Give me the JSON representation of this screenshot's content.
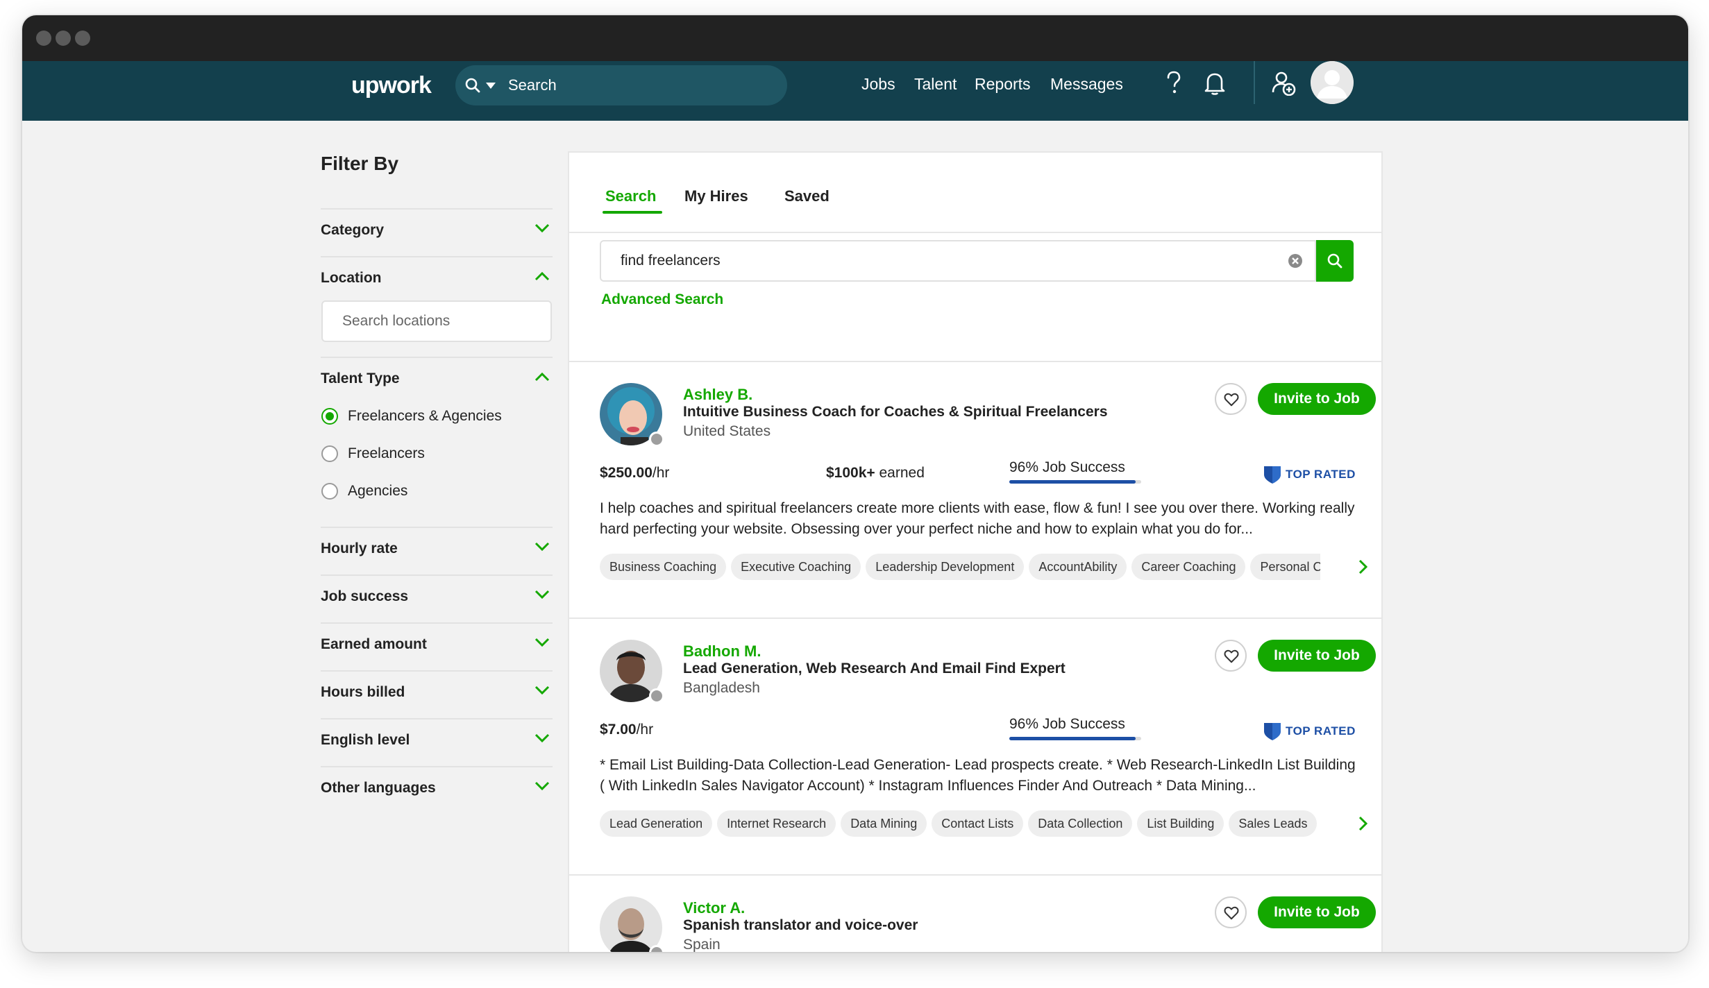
{
  "nav": {
    "logo": "upwork",
    "search_placeholder": "Search",
    "links": [
      "Jobs",
      "Talent",
      "Reports",
      "Messages"
    ],
    "help_icon": "help-icon",
    "bell_icon": "bell-icon",
    "add_user_icon": "add-user-icon",
    "avatar_icon": "avatar-icon"
  },
  "sidebar": {
    "title": "Filter By",
    "filters": {
      "category": "Category",
      "location": "Location",
      "location_placeholder": "Search locations",
      "talent_type": "Talent Type",
      "talent_options": [
        "Freelancers & Agencies",
        "Freelancers",
        "Agencies"
      ],
      "talent_selected": "Freelancers & Agencies",
      "hourly_rate": "Hourly rate",
      "job_success": "Job success",
      "earned_amount": "Earned amount",
      "hours_billed": "Hours billed",
      "english_level": "English level",
      "other_languages": "Other languages"
    }
  },
  "main": {
    "tabs": [
      "Search",
      "My Hires",
      "Saved"
    ],
    "active_tab": "Search",
    "query": "find freelancers",
    "advanced_search": "Advanced Search",
    "invite_label": "Invite to Job",
    "freelancers": [
      {
        "name": "Ashley B.",
        "title": "Intuitive Business Coach for Coaches & Spiritual Freelancers",
        "country": "United States",
        "rate": "$250.00",
        "rate_unit": "/hr",
        "earned_value": "$100k+",
        "earned_suffix": " earned",
        "job_success": "96% Job Success",
        "job_success_pct": 96,
        "badge": "TOP RATED",
        "description": "I help coaches and spiritual freelancers create more clients with ease, flow & fun! I see you over there. Working really hard perfecting your website. Obsessing over your perfect niche and how to explain what you do for...",
        "skills": [
          "Business Coaching",
          "Executive Coaching",
          "Leadership Development",
          "AccountAbility",
          "Career Coaching",
          "Personal Coaching"
        ]
      },
      {
        "name": "Badhon M.",
        "title": "Lead Generation, Web Research And Email Find Expert",
        "country": "Bangladesh",
        "rate": "$7.00",
        "rate_unit": "/hr",
        "job_success": "96% Job Success",
        "job_success_pct": 96,
        "badge": "TOP RATED",
        "description": "* Email List Building-Data Collection-Lead Generation- Lead prospects create. * Web Research-LinkedIn List Building ( With LinkedIn Sales Navigator Account) * Instagram Influences Finder And Outreach * Data Mining...",
        "skills": [
          "Lead Generation",
          "Internet Research",
          "Data Mining",
          "Contact Lists",
          "Data Collection",
          "List Building",
          "Sales Leads"
        ]
      },
      {
        "name": "Victor A.",
        "title": "Spanish translator and voice-over",
        "country": "Spain"
      }
    ]
  },
  "colors": {
    "brand_green": "#14a800",
    "nav_bg": "#13404d",
    "badge_blue": "#1d4fa5"
  }
}
